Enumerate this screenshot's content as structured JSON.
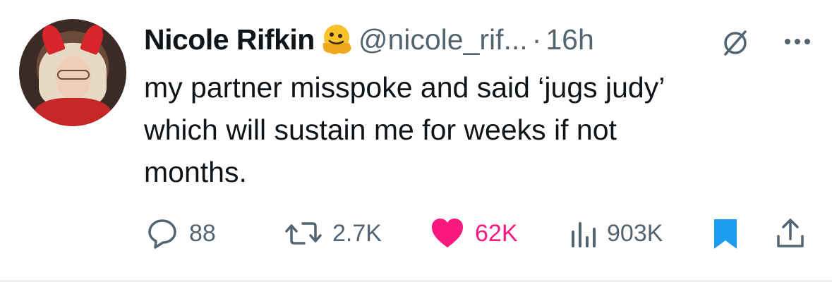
{
  "author": {
    "display_name": "Nicole Rifkin",
    "handle": "@nicole_rif...",
    "separator": "·",
    "time": "16h",
    "avatar_icon": "profile-photo",
    "badge_icon": "melting-face-emoji",
    "status_icon": "prohibited-icon",
    "more_icon": "more-icon"
  },
  "tweet": {
    "lines": [
      "my partner misspoke and said ‘jugs judy’",
      "which will sustain me for weeks if not",
      "months."
    ]
  },
  "actions": {
    "reply": {
      "icon": "reply-icon",
      "count": "88"
    },
    "retweet": {
      "icon": "retweet-icon",
      "count": "2.7K"
    },
    "like": {
      "icon": "heart-icon",
      "count": "62K",
      "color": "#f91880",
      "active": true
    },
    "views": {
      "icon": "views-icon",
      "count": "903K"
    },
    "bookmark": {
      "icon": "bookmark-icon",
      "color": "#1d9bf0",
      "active": true
    },
    "share": {
      "icon": "share-icon"
    }
  },
  "colors": {
    "text": "#0f1419",
    "secondary": "#536471",
    "like": "#f91880",
    "bookmark": "#1d9bf0"
  }
}
